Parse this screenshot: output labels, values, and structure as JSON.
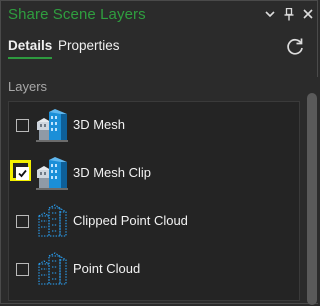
{
  "window": {
    "title": "Share Scene Layers",
    "controls": {
      "menu_icon": "chevron-down-icon",
      "pin_icon": "pin-icon",
      "close_icon": "close-icon"
    }
  },
  "tabs": [
    {
      "label": "Details",
      "active": true
    },
    {
      "label": "Properties",
      "active": false
    }
  ],
  "toolbar": {
    "refresh_icon": "refresh-icon"
  },
  "layers_section": {
    "label": "Layers",
    "items": [
      {
        "label": "3D Mesh",
        "checked": false,
        "icon": "mesh-layer-icon"
      },
      {
        "label": "3D Mesh Clip",
        "checked": true,
        "highlighted": true,
        "icon": "mesh-layer-icon"
      },
      {
        "label": "Clipped Point Cloud",
        "checked": false,
        "icon": "point-cloud-layer-icon"
      },
      {
        "label": "Point Cloud",
        "checked": false,
        "icon": "point-cloud-layer-icon"
      }
    ]
  },
  "colors": {
    "accent": "#2e9a3f",
    "highlight": "#f3f000",
    "background": "#2b2b2b"
  }
}
